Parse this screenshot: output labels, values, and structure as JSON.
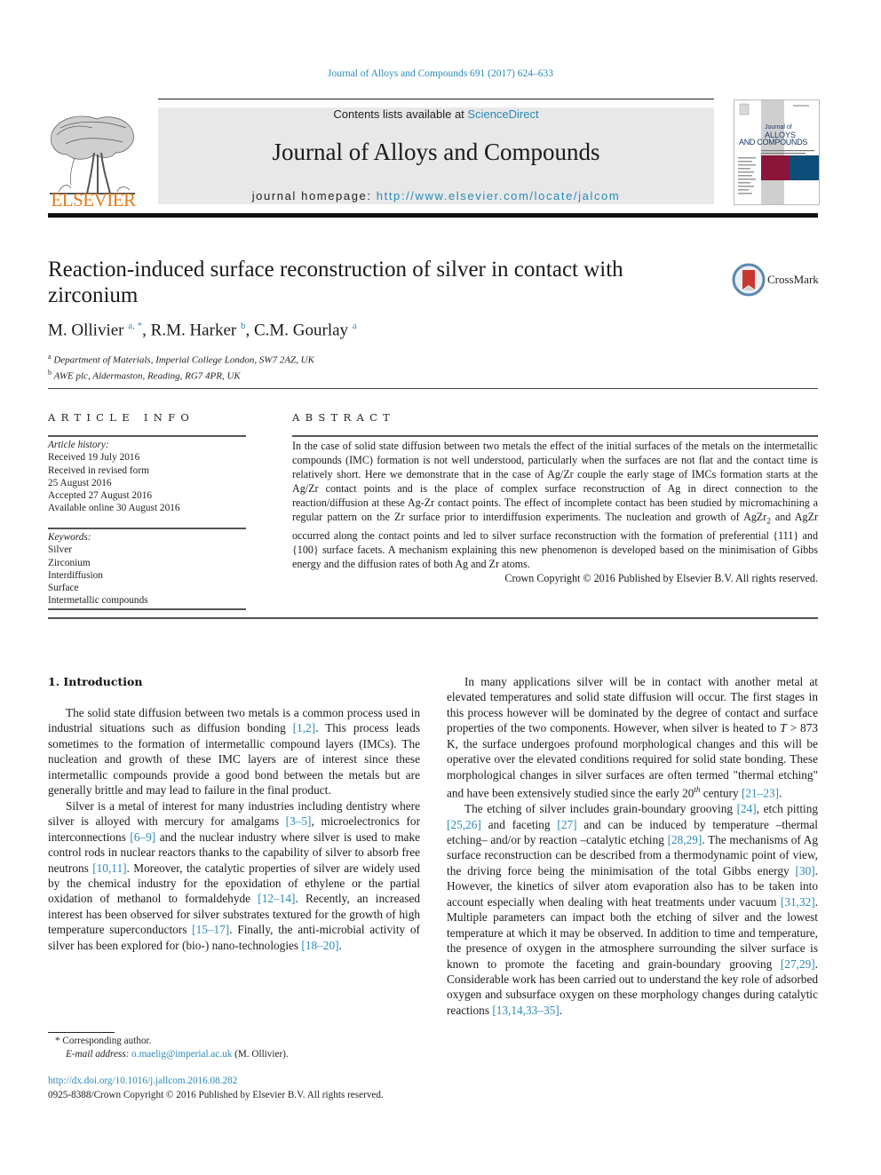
{
  "running_head": "Journal of Alloys and Compounds 691 (2017) 624–633",
  "header": {
    "contents_prefix": "Contents lists available at ",
    "contents_link": "ScienceDirect",
    "journal_title": "Journal of Alloys and Compounds",
    "homepage_prefix": "journal homepage: ",
    "homepage_link": "http://www.elsevier.com/locate/jalcom",
    "publisher_logo_text": "ELSEVIER",
    "cover": {
      "title_line1": "Journal of",
      "title_line2": "ALLOYS",
      "title_line3": "AND COMPOUNDS",
      "colors": {
        "left_block": "#8b1538",
        "right_block": "#0e4d7a",
        "band": "#c8c8c8"
      }
    }
  },
  "article": {
    "title": "Reaction-induced surface reconstruction of silver in contact with zirconium",
    "crossmark_label": "CrossMark",
    "authors": [
      {
        "name": "M. Ollivier",
        "sup": "a, *"
      },
      {
        "name": "R.M. Harker",
        "sup": "b"
      },
      {
        "name": "C.M. Gourlay",
        "sup": "a"
      }
    ],
    "affiliations": [
      {
        "mark": "a",
        "text": "Department of Materials, Imperial College London, SW7 2AZ, UK"
      },
      {
        "mark": "b",
        "text": "AWE plc, Aldermaston, Reading, RG7 4PR, UK"
      }
    ]
  },
  "article_info": {
    "heading": "ARTICLE INFO",
    "history_caption": "Article history:",
    "history": [
      "Received 19 July 2016",
      "Received in revised form",
      "25 August 2016",
      "Accepted 27 August 2016",
      "Available online 30 August 2016"
    ],
    "keywords_caption": "Keywords:",
    "keywords": [
      "Silver",
      "Zirconium",
      "Interdiffusion",
      "Surface",
      "Intermetallic compounds"
    ]
  },
  "abstract": {
    "heading": "ABSTRACT",
    "text_before_sub": "In the case of solid state diffusion between two metals the effect of the initial surfaces of the metals on the intermetallic compounds (IMC) formation is not well understood, particularly when the surfaces are not flat and the contact time is relatively short. Here we demonstrate that in the case of Ag/Zr couple the early stage of IMCs formation starts at the Ag/Zr contact points and is the place of complex surface reconstruction of Ag in direct connection to the reaction/diffusion at these Ag-Zr contact points. The effect of incomplete contact has been studied by micromachining a regular pattern on the Zr surface prior to interdiffusion experiments. The nucleation and growth of AgZr",
    "subscript": "2",
    "text_after_sub": " and AgZr occurred along the contact points and led to silver surface reconstruction with the formation of preferential {111} and {100} surface facets. A mechanism explaining this new phenomenon is developed based on the minimisation of Gibbs energy and the diffusion rates of both Ag and Zr atoms.",
    "copyright": "Crown Copyright © 2016 Published by Elsevier B.V. All rights reserved."
  },
  "body": {
    "section_heading": "1.  Introduction",
    "left_paragraphs": [
      [
        {
          "t": "The solid state diffusion between two metals is a common process used in industrial situations such as diffusion bonding "
        },
        {
          "c": "[1,2]"
        },
        {
          "t": ". This process leads sometimes to the formation of intermetallic compound layers (IMCs). The nucleation and growth of these IMC layers are of interest since these intermetallic compounds provide a good bond between the metals but are generally brittle and may lead to failure in the final product."
        }
      ],
      [
        {
          "t": "Silver is a metal of interest for many industries including dentistry where silver is alloyed with mercury for amalgams "
        },
        {
          "c": "[3–5]"
        },
        {
          "t": ", microelectronics for interconnections "
        },
        {
          "c": "[6–9]"
        },
        {
          "t": " and the nuclear industry where silver is used to make control rods in nuclear reactors thanks to the capability of silver to absorb free neutrons "
        },
        {
          "c": "[10,11]"
        },
        {
          "t": ". Moreover, the catalytic properties of silver are widely used by the chemical industry for the epoxidation of ethylene or the partial oxidation of methanol to formaldehyde "
        },
        {
          "c": "[12–14]"
        },
        {
          "t": ". Recently, an increased interest has been observed for silver substrates textured for the growth of high temperature superconductors "
        },
        {
          "c": "[15–17]"
        },
        {
          "t": ". Finally, the anti-microbial activity of silver has been explored for (bio-) nano-technologies "
        },
        {
          "c": "[18–20]"
        },
        {
          "t": "."
        }
      ]
    ],
    "right_paragraphs": [
      [
        {
          "t": "In many applications silver will be in contact with another metal at elevated temperatures and solid state diffusion will occur. The first stages in this process however will be dominated by the degree of contact and surface properties of the two components. However, when silver is heated to "
        },
        {
          "i": "T"
        },
        {
          "t": " > 873 K, the surface undergoes profound morphological changes and this will be operative over the elevated conditions required for solid state bonding. These morphological changes in silver surfaces are often termed \"thermal etching\" and have been extensively studied since the early 20"
        },
        {
          "sup": "th"
        },
        {
          "t": " century "
        },
        {
          "c": "[21–23]"
        },
        {
          "t": "."
        }
      ],
      [
        {
          "t": "The etching of silver includes grain-boundary grooving "
        },
        {
          "c": "[24]"
        },
        {
          "t": ", etch pitting "
        },
        {
          "c": "[25,26]"
        },
        {
          "t": " and faceting "
        },
        {
          "c": "[27]"
        },
        {
          "t": " and can be induced by temperature –thermal etching– and/or by reaction –catalytic etching "
        },
        {
          "c": "[28,29]"
        },
        {
          "t": ". The mechanisms of Ag surface reconstruction can be described from a thermodynamic point of view, the driving force being the minimisation of the total Gibbs energy "
        },
        {
          "c": "[30]"
        },
        {
          "t": ". However, the kinetics of silver atom evaporation also has to be taken into account especially when dealing with heat treatments under vacuum "
        },
        {
          "c": "[31,32]"
        },
        {
          "t": ". Multiple parameters can impact both the etching of silver and the lowest temperature at which it may be observed. In addition to time and temperature, the presence of oxygen in the atmosphere surrounding the silver surface is known to promote the faceting and grain-boundary grooving "
        },
        {
          "c": "[27,29]"
        },
        {
          "t": ". Considerable work has been carried out to understand the key role of adsorbed oxygen and subsurface oxygen on these morphology changes during catalytic reactions "
        },
        {
          "c": "[13,14,33–35]"
        },
        {
          "t": "."
        }
      ]
    ]
  },
  "footnotes": {
    "corresponding_mark": "*",
    "corresponding_text": "Corresponding author.",
    "email_label": "E-mail address:",
    "email": "o.maelig@imperial.ac.uk",
    "email_owner": "(M. Ollivier)."
  },
  "doi": {
    "link": "http://dx.doi.org/10.1016/j.jallcom.2016.08.282",
    "issn_line": "0925-8388/Crown Copyright © 2016 Published by Elsevier B.V. All rights reserved."
  },
  "colors": {
    "link": "#2a8ab8",
    "elsevier_orange": "#e77817",
    "banner_gray": "#e8e8e8",
    "crossmark_red": "#c7372f",
    "crossmark_ring": "#5a87b0"
  }
}
